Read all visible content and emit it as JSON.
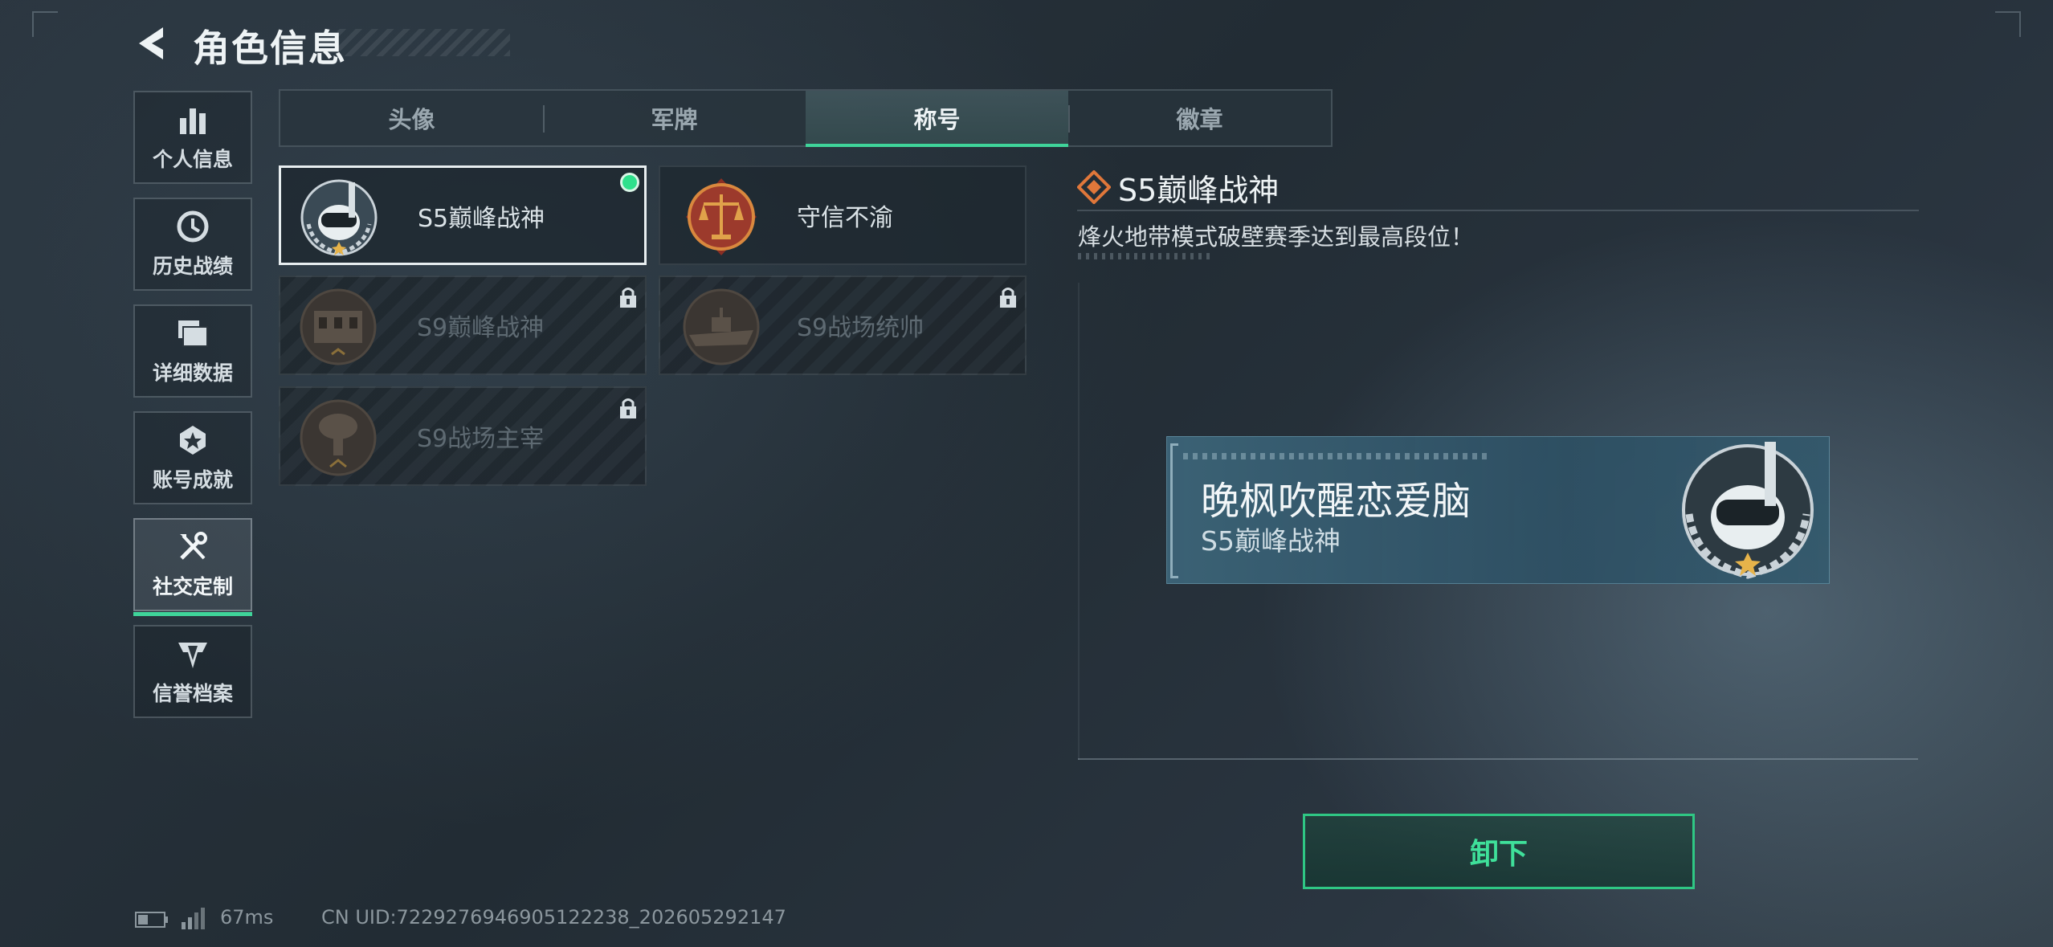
{
  "header": {
    "title": "角色信息"
  },
  "sidebar": {
    "items": [
      {
        "label": "个人信息",
        "icon": "bar-chart-icon"
      },
      {
        "label": "历史战绩",
        "icon": "history-clock-icon"
      },
      {
        "label": "详细数据",
        "icon": "folder-icon"
      },
      {
        "label": "账号成就",
        "icon": "achievement-star-icon"
      },
      {
        "label": "社交定制",
        "icon": "tools-icon",
        "active": true
      },
      {
        "label": "信誉档案",
        "icon": "shield-wings-icon"
      }
    ]
  },
  "tabs": [
    {
      "label": "头像"
    },
    {
      "label": "军牌"
    },
    {
      "label": "称号",
      "active": true
    },
    {
      "label": "徽章"
    }
  ],
  "titles": [
    {
      "name": "S5巅峰战神",
      "emblem": "diver-skull-emblem",
      "selected": true,
      "equipped": true
    },
    {
      "name": "守信不渝",
      "emblem": "scales-emblem"
    },
    {
      "name": "S9巅峰战神",
      "emblem": "fortress-emblem",
      "locked": true
    },
    {
      "name": "S9战场统帅",
      "emblem": "warship-emblem",
      "locked": true
    },
    {
      "name": "S9战场主宰",
      "emblem": "mushroom-cloud-emblem",
      "locked": true
    }
  ],
  "detail": {
    "title": "S5巅峰战神",
    "description": "烽火地带模式破壁赛季达到最高段位！"
  },
  "preview": {
    "player_name": "晚枫吹醒恋爱脑",
    "title": "S5巅峰战神"
  },
  "action": {
    "unequip_label": "卸下"
  },
  "status": {
    "ping": "67ms",
    "uid": "CN UID:7229276946905122238_202605292147"
  },
  "colors": {
    "accent": "#3fd49a",
    "equipped_dot": "#2fe08c",
    "detail_icon": "#e0773a"
  }
}
